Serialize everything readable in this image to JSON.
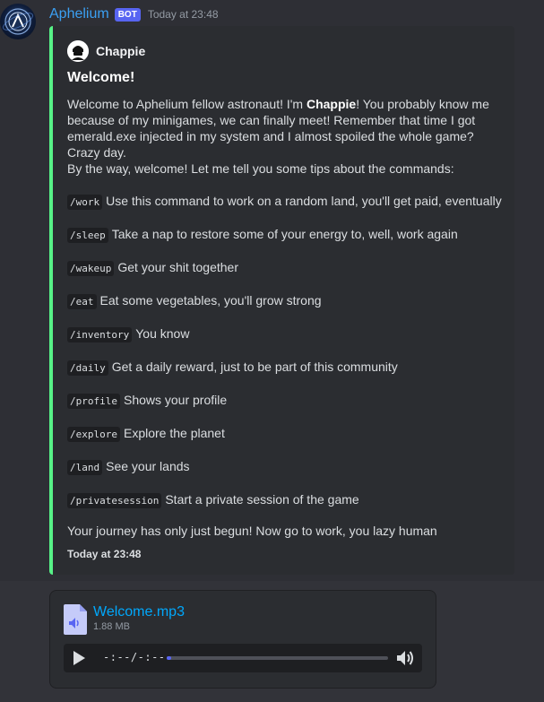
{
  "message": {
    "username": "Aphelium",
    "bot_tag": "BOT",
    "timestamp": "Today at 23:48"
  },
  "embed": {
    "accent_color": "#57f287",
    "author": "Chappie",
    "title": "Welcome!",
    "intro_before": "Welcome to Aphelium fellow astronaut! I'm ",
    "intro_bold": "Chappie",
    "intro_after": "! You probably know me because of my minigames, we can finally meet! Remember that time I got emerald.exe injected in my system and I almost spoiled the whole game? Crazy day.",
    "intro_line2": "By the way, welcome! Let me tell you some tips about the commands:",
    "commands": [
      {
        "command": "/work",
        "description": "Use this command to work on a random land, you'll get paid, eventually"
      },
      {
        "command": "/sleep",
        "description": "Take a nap to restore some of your energy to, well, work again"
      },
      {
        "command": "/wakeup",
        "description": "Get your shit together"
      },
      {
        "command": "/eat",
        "description": "Eat some vegetables, you'll grow strong"
      },
      {
        "command": "/inventory",
        "description": "You know"
      },
      {
        "command": "/daily",
        "description": "Get a daily reward, just to be part of this community"
      },
      {
        "command": "/profile",
        "description": "Shows your profile"
      },
      {
        "command": "/explore",
        "description": "Explore the planet"
      },
      {
        "command": "/land",
        "description": "See your lands"
      },
      {
        "command": "/privatesession",
        "description": "Start a private session of the game"
      }
    ],
    "closing": "Your journey has only just begun! Now go to work, you lazy human",
    "footer": "Today at 23:48"
  },
  "attachment": {
    "file_name": "Welcome.mp3",
    "file_size": "1.88 MB",
    "time_display": "-:--/-:--",
    "progress_fraction": 0.02
  },
  "colors": {
    "username": "#3ba0f3",
    "bot_tag": "#5865f2",
    "link": "#00a8fc"
  },
  "icons": {
    "avatar": "aphelium-logo",
    "author": "chappie-robot-icon",
    "file": "audio-file-icon",
    "play": "play-icon",
    "volume": "volume-icon"
  }
}
